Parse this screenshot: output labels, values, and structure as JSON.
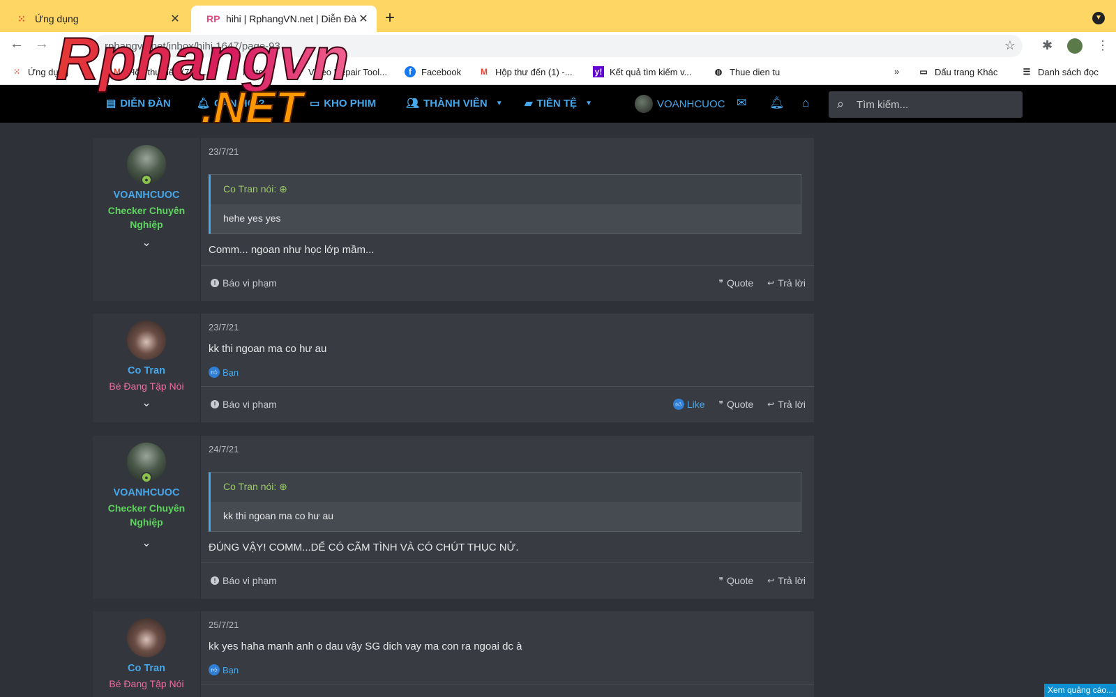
{
  "browser": {
    "tabs": [
      {
        "title": "Ứng dụng",
        "close": "✕"
      },
      {
        "title": "hihi | RphangVN.net | Diễn Đàn",
        "favicon": "RP",
        "close": "✕"
      }
    ],
    "new_tab": "+",
    "url": "rphangvn.net/inbox/hihi.1647/page-93",
    "bookmarks": [
      "Ứng dụng",
      "Hộp thư đến (758...",
      "History",
      "Video Repair Tool...",
      "Facebook",
      "Hộp thư đến (1) -...",
      "Kết quả tìm kiếm v...",
      "Thue dien tu"
    ],
    "bookmarks_more": "»",
    "bookmarks_other": "Dấu trang Khác",
    "reading_list": "Danh sách đọc"
  },
  "logo": {
    "top": "Rphangvn",
    "bottom": ".NET"
  },
  "forum_nav": {
    "items": [
      "DIỄN ĐÀN",
      "CẦN HỎI?",
      "KHO PHIM",
      "THÀNH VIÊN",
      "TIỀN TỆ"
    ],
    "user": "VOANHCUOC",
    "search_placeholder": "Tìm kiếm..."
  },
  "posts": [
    {
      "user": "VOANHCUOC",
      "title": "Checker Chuyên Nghiệp",
      "date": "23/7/21",
      "quote_author": "Co Tran nói:",
      "quote_text": "hehe yes yes",
      "text": "Comm... ngoan như học lớp mầm..."
    },
    {
      "user": "Co Tran",
      "title": "Bé Đang Tập Nói",
      "date": "23/7/21",
      "text": "kk thi ngoan ma co hư au",
      "reaction": "Bạn"
    },
    {
      "user": "VOANHCUOC",
      "title": "Checker Chuyên Nghiệp",
      "date": "24/7/21",
      "quote_author": "Co Tran nói:",
      "quote_text": "kk thi ngoan ma co hư au",
      "text": "ĐÚNG VẬY! COMM...DỂ CÓ CÃM TÌNH VÀ CÓ CHÚT THỤC NỬ."
    },
    {
      "user": "Co Tran",
      "title": "Bé Đang Tập Nói",
      "date": "25/7/21",
      "text": "kk yes haha manh anh o dau vậy SG dich vay ma con ra ngoai dc à",
      "reaction": "Bạn"
    }
  ],
  "post_actions": {
    "report": "Báo vi phạm",
    "like": "Like",
    "quote": "Quote",
    "reply": "Trả lời"
  },
  "ad": "Xem quảng cáo...",
  "colors": {
    "accent": "#47a7eb",
    "tabbar": "#fdd663",
    "green_title": "#5ed35e",
    "pink_title": "#f06ba0"
  }
}
